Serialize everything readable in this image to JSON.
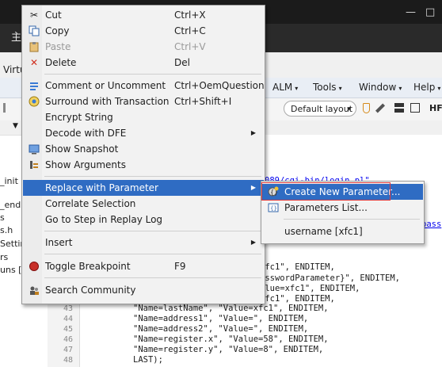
{
  "window": {
    "title_glyph": "主",
    "minimize": "—",
    "maximize": "□",
    "caption": "Virtu"
  },
  "menubar": {
    "items": [
      {
        "label": "ALM"
      },
      {
        "label": "Tools"
      },
      {
        "label": "Window"
      },
      {
        "label": "Help"
      }
    ]
  },
  "toolbar": {
    "layout_select": "Default layout",
    "hp_label": "HF"
  },
  "tree": {
    "items": [
      "_init",
      "_end",
      "s",
      "s.h",
      "Settin",
      "rs",
      "uns [I"
    ]
  },
  "editor": {
    "lines": [
      {
        "num": "",
        "code": "089/cgi-bin/login.pl\","
      },
      {
        "num": "",
        "code": "pass"
      },
      {
        "num": "",
        "code": "xfc1\", ENDITEM,"
      },
      {
        "num": "",
        "code": "asswordParameter}\", ENDITEM,"
      },
      {
        "num": "",
        "code": "alue=xfc1\", ENDITEM,"
      },
      {
        "num": "",
        "code": "xfc1\", ENDITEM,"
      },
      {
        "num": "43",
        "code": "\"Name=lastName\", \"Value=xfc1\", ENDITEM,"
      },
      {
        "num": "44",
        "code": "\"Name=address1\", \"Value=\", ENDITEM,"
      },
      {
        "num": "45",
        "code": "\"Name=address2\", \"Value=\", ENDITEM,"
      },
      {
        "num": "46",
        "code": "\"Name=register.x\", \"Value=58\", ENDITEM,"
      },
      {
        "num": "47",
        "code": "\"Name=register.y\", \"Value=8\", ENDITEM,"
      },
      {
        "num": "48",
        "code": "LAST);"
      }
    ]
  },
  "context_menu": {
    "items": [
      {
        "label": "Cut",
        "shortcut": "Ctrl+X",
        "icon": "scissors-icon"
      },
      {
        "label": "Copy",
        "shortcut": "Ctrl+C",
        "icon": "copy-icon"
      },
      {
        "label": "Paste",
        "shortcut": "Ctrl+V",
        "icon": "paste-icon",
        "disabled": true
      },
      {
        "label": "Delete",
        "shortcut": "Del",
        "icon": "delete-icon"
      },
      {
        "label": "Comment or Uncomment",
        "shortcut": "Ctrl+OemQuestion",
        "icon": "comment-icon"
      },
      {
        "label": "Surround with Transaction",
        "shortcut": "Ctrl+Shift+I",
        "icon": "transaction-icon"
      },
      {
        "label": "Encrypt String",
        "shortcut": "",
        "icon": ""
      },
      {
        "label": "Decode with DFE",
        "shortcut": "",
        "icon": "",
        "submenu": true
      },
      {
        "label": "Show Snapshot",
        "shortcut": "",
        "icon": "snapshot-icon"
      },
      {
        "label": "Show Arguments",
        "shortcut": "",
        "icon": "arguments-icon"
      },
      {
        "label": "Replace with Parameter",
        "shortcut": "",
        "icon": "",
        "submenu": true,
        "highlighted": true
      },
      {
        "label": "Correlate Selection",
        "shortcut": "",
        "icon": ""
      },
      {
        "label": "Go to Step in Replay Log",
        "shortcut": "",
        "icon": ""
      },
      {
        "label": "Insert",
        "shortcut": "",
        "icon": "",
        "submenu": true
      },
      {
        "label": "Toggle Breakpoint",
        "shortcut": "F9",
        "icon": "breakpoint-icon"
      },
      {
        "label": "Search Community",
        "shortcut": "",
        "icon": "community-icon"
      }
    ]
  },
  "submenu": {
    "items": [
      {
        "label": "Create New Parameter...",
        "icon": "new-parameter-icon",
        "highlighted": true
      },
      {
        "label": "Parameters List...",
        "icon": "parameters-list-icon"
      },
      {
        "label": "username [xfc1]",
        "icon": ""
      }
    ]
  },
  "colors": {
    "highlight": "#2f6cc3",
    "annotation_box": "#e23a3a",
    "string": "#0000ee"
  }
}
